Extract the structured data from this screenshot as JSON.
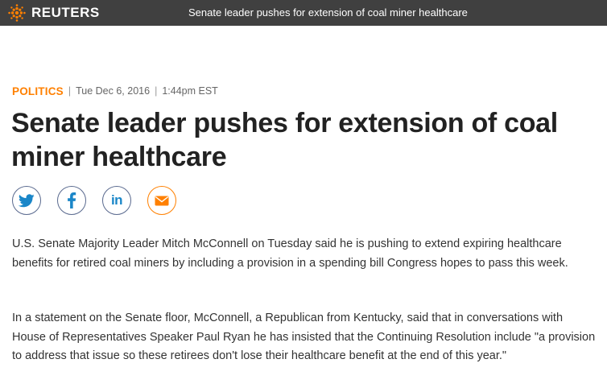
{
  "header": {
    "brand": "REUTERS",
    "headline": "Senate leader pushes for extension of coal miner healthcare",
    "colors": {
      "bar": "#404040",
      "logo": "#ff8000"
    }
  },
  "article": {
    "section": "POLITICS",
    "date": "Tue Dec 6, 2016",
    "time": "1:44pm EST",
    "title": "Senate leader pushes for extension of coal miner healthcare",
    "share": {
      "icons": [
        "twitter-icon",
        "facebook-icon",
        "linkedin-icon",
        "email-icon"
      ],
      "linkedin_label": "in"
    },
    "paragraphs": [
      "U.S. Senate Majority Leader Mitch McConnell on Tuesday said he is pushing to extend expiring healthcare benefits for retired coal miners by including a provision in a spending bill Congress hopes to pass this week.",
      "In a statement on the Senate floor, McConnell, a Republican from Kentucky, said that in conversations with House of Representatives Speaker Paul Ryan he has insisted that the Continuing Resolution include \"a provision to address that issue so these retirees don't lose their healthcare benefit at the end of this year.\""
    ],
    "colors": {
      "section": "#ff8000",
      "share_border": "#5a6a8f",
      "share_icon": "#1a86c8",
      "mail": "#ff8000"
    }
  }
}
